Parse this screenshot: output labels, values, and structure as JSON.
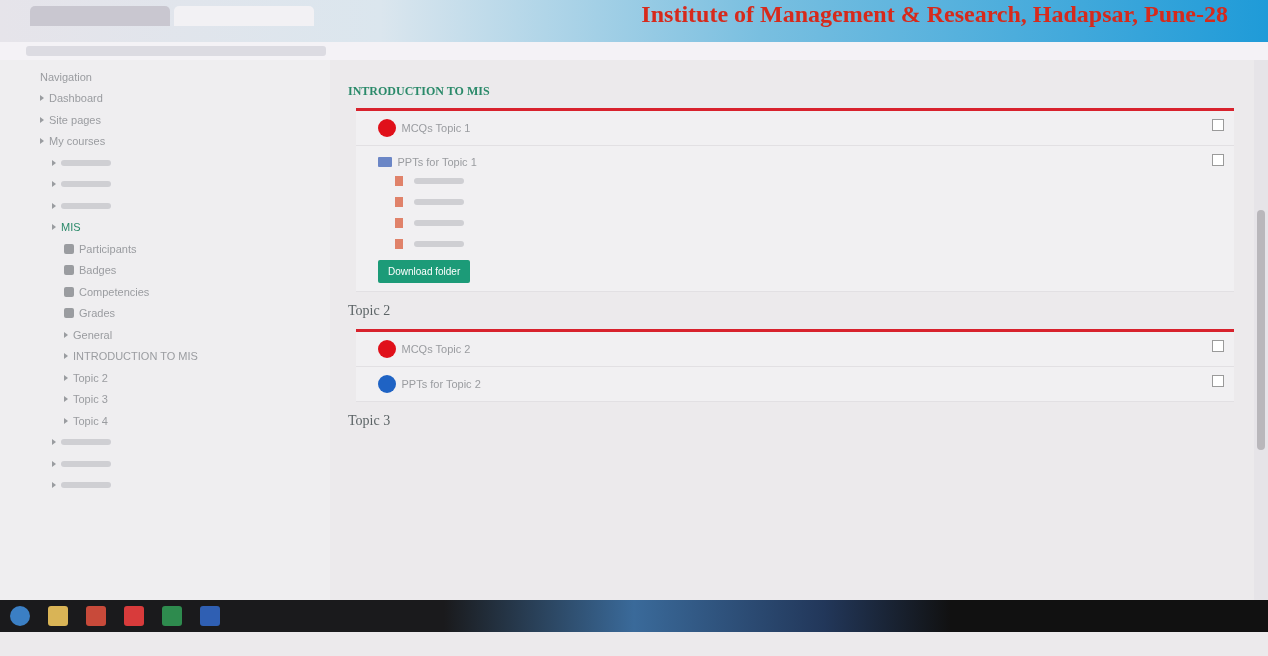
{
  "browser": {
    "tabs": [
      {
        "selected": false
      },
      {
        "selected": true
      }
    ]
  },
  "banner": {
    "text": "Institute of Management & Research, Hadapsar, Pune-28"
  },
  "sidebar": {
    "heading": "Navigation",
    "items": [
      {
        "kind": "branch",
        "label": "Dashboard"
      },
      {
        "kind": "branch",
        "label": "Site pages"
      },
      {
        "kind": "branch",
        "label": "My courses",
        "children": [
          {
            "kind": "blurred"
          },
          {
            "kind": "blurred"
          },
          {
            "kind": "blurred"
          },
          {
            "kind": "branch",
            "label": "MIS",
            "children": [
              {
                "kind": "tool",
                "label": "Participants"
              },
              {
                "kind": "tool",
                "label": "Badges"
              },
              {
                "kind": "tool",
                "label": "Competencies"
              },
              {
                "kind": "tool",
                "label": "Grades"
              },
              {
                "kind": "branch",
                "label": "General"
              },
              {
                "kind": "branch",
                "label": "INTRODUCTION TO MIS"
              },
              {
                "kind": "branch",
                "label": "Topic 2"
              },
              {
                "kind": "branch",
                "label": "Topic 3"
              },
              {
                "kind": "branch",
                "label": "Topic 4"
              }
            ]
          },
          {
            "kind": "blurred"
          },
          {
            "kind": "blurred"
          },
          {
            "kind": "blurred"
          }
        ]
      }
    ]
  },
  "sections": [
    {
      "title": "INTRODUCTION TO MIS",
      "kind": "intro",
      "activities": [
        {
          "kind": "quiz",
          "label": "MCQs Topic 1",
          "color": "#e0101a",
          "completed": false
        },
        {
          "kind": "folder",
          "label": "PPTs for Topic 1",
          "button": "Download folder",
          "completed": false
        }
      ]
    },
    {
      "title": "Topic 2",
      "kind": "topic",
      "activities": [
        {
          "kind": "quiz",
          "label": "MCQs Topic 2",
          "color": "#e0101a",
          "completed": false
        },
        {
          "kind": "quiz",
          "label": "PPTs for Topic 2",
          "color": "#1f63c4",
          "completed": false
        }
      ]
    },
    {
      "title": "Topic 3",
      "kind": "topic"
    }
  ]
}
